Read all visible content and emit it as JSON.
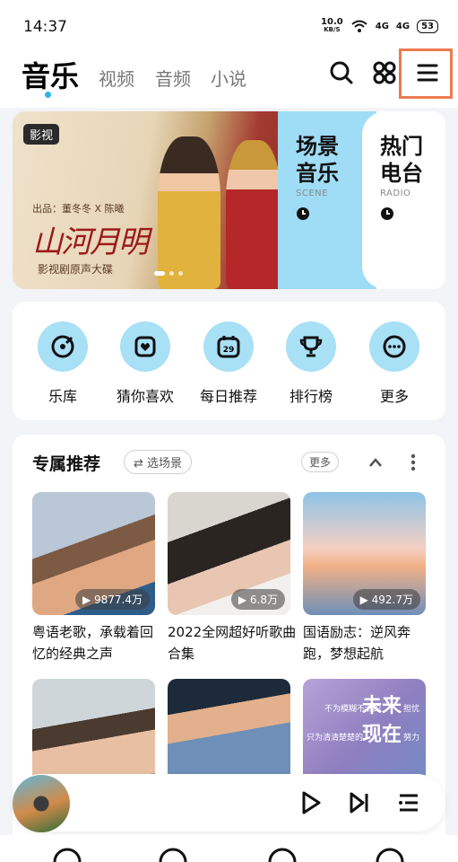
{
  "status": {
    "time": "14:37",
    "speed": "10.0",
    "speed_unit": "KB/S",
    "net1": "4G",
    "net2": "4G",
    "battery": "53"
  },
  "header": {
    "tabs": [
      {
        "label": "音乐"
      },
      {
        "label": "视频"
      },
      {
        "label": "音频"
      },
      {
        "label": "小说"
      }
    ],
    "active_tab": "音乐"
  },
  "banner": {
    "tag": "影视",
    "poster_credit": "出品：董冬冬 X 陈曦",
    "poster_title": "山河月明",
    "poster_subtitle": "影视剧原声大碟",
    "scene": {
      "title_line1": "场景",
      "title_line2": "音乐",
      "en": "SCENE"
    },
    "radio": {
      "title_line1": "热门",
      "title_line2": "电台",
      "en": "RADIO"
    }
  },
  "quick_nav": [
    {
      "label": "乐库",
      "icon": "music-library-icon"
    },
    {
      "label": "猜你喜欢",
      "icon": "heart-box-icon"
    },
    {
      "label": "每日推荐",
      "icon": "calendar-icon",
      "badge": "29"
    },
    {
      "label": "排行榜",
      "icon": "trophy-icon"
    },
    {
      "label": "更多",
      "icon": "more-icon"
    }
  ],
  "recommend": {
    "title": "专属推荐",
    "scene_chip": "选场景",
    "more_label": "更多",
    "playlists": [
      {
        "plays": "9877.4万",
        "title": "粤语老歌，承载着回忆的经典之声"
      },
      {
        "plays": "6.8万",
        "title": "2022全网超好听歌曲合集"
      },
      {
        "plays": "492.7万",
        "title": "国语励志：逆风奔跑，梦想起航"
      }
    ],
    "row2": [
      {
        "text": ""
      },
      {
        "text": ""
      },
      {
        "text_big1": "未来",
        "text_big2": "现在",
        "text_small1": "不为模糊不清的",
        "text_small1b": "担忧",
        "text_small2": "只为清清楚楚的",
        "text_small2b": "努力"
      }
    ]
  },
  "colors": {
    "accent": "#2bb4e8",
    "highlight_box": "#ec7a4f",
    "scene_bg": "#9fdcf5",
    "icon_bg": "#a8e0f6"
  }
}
